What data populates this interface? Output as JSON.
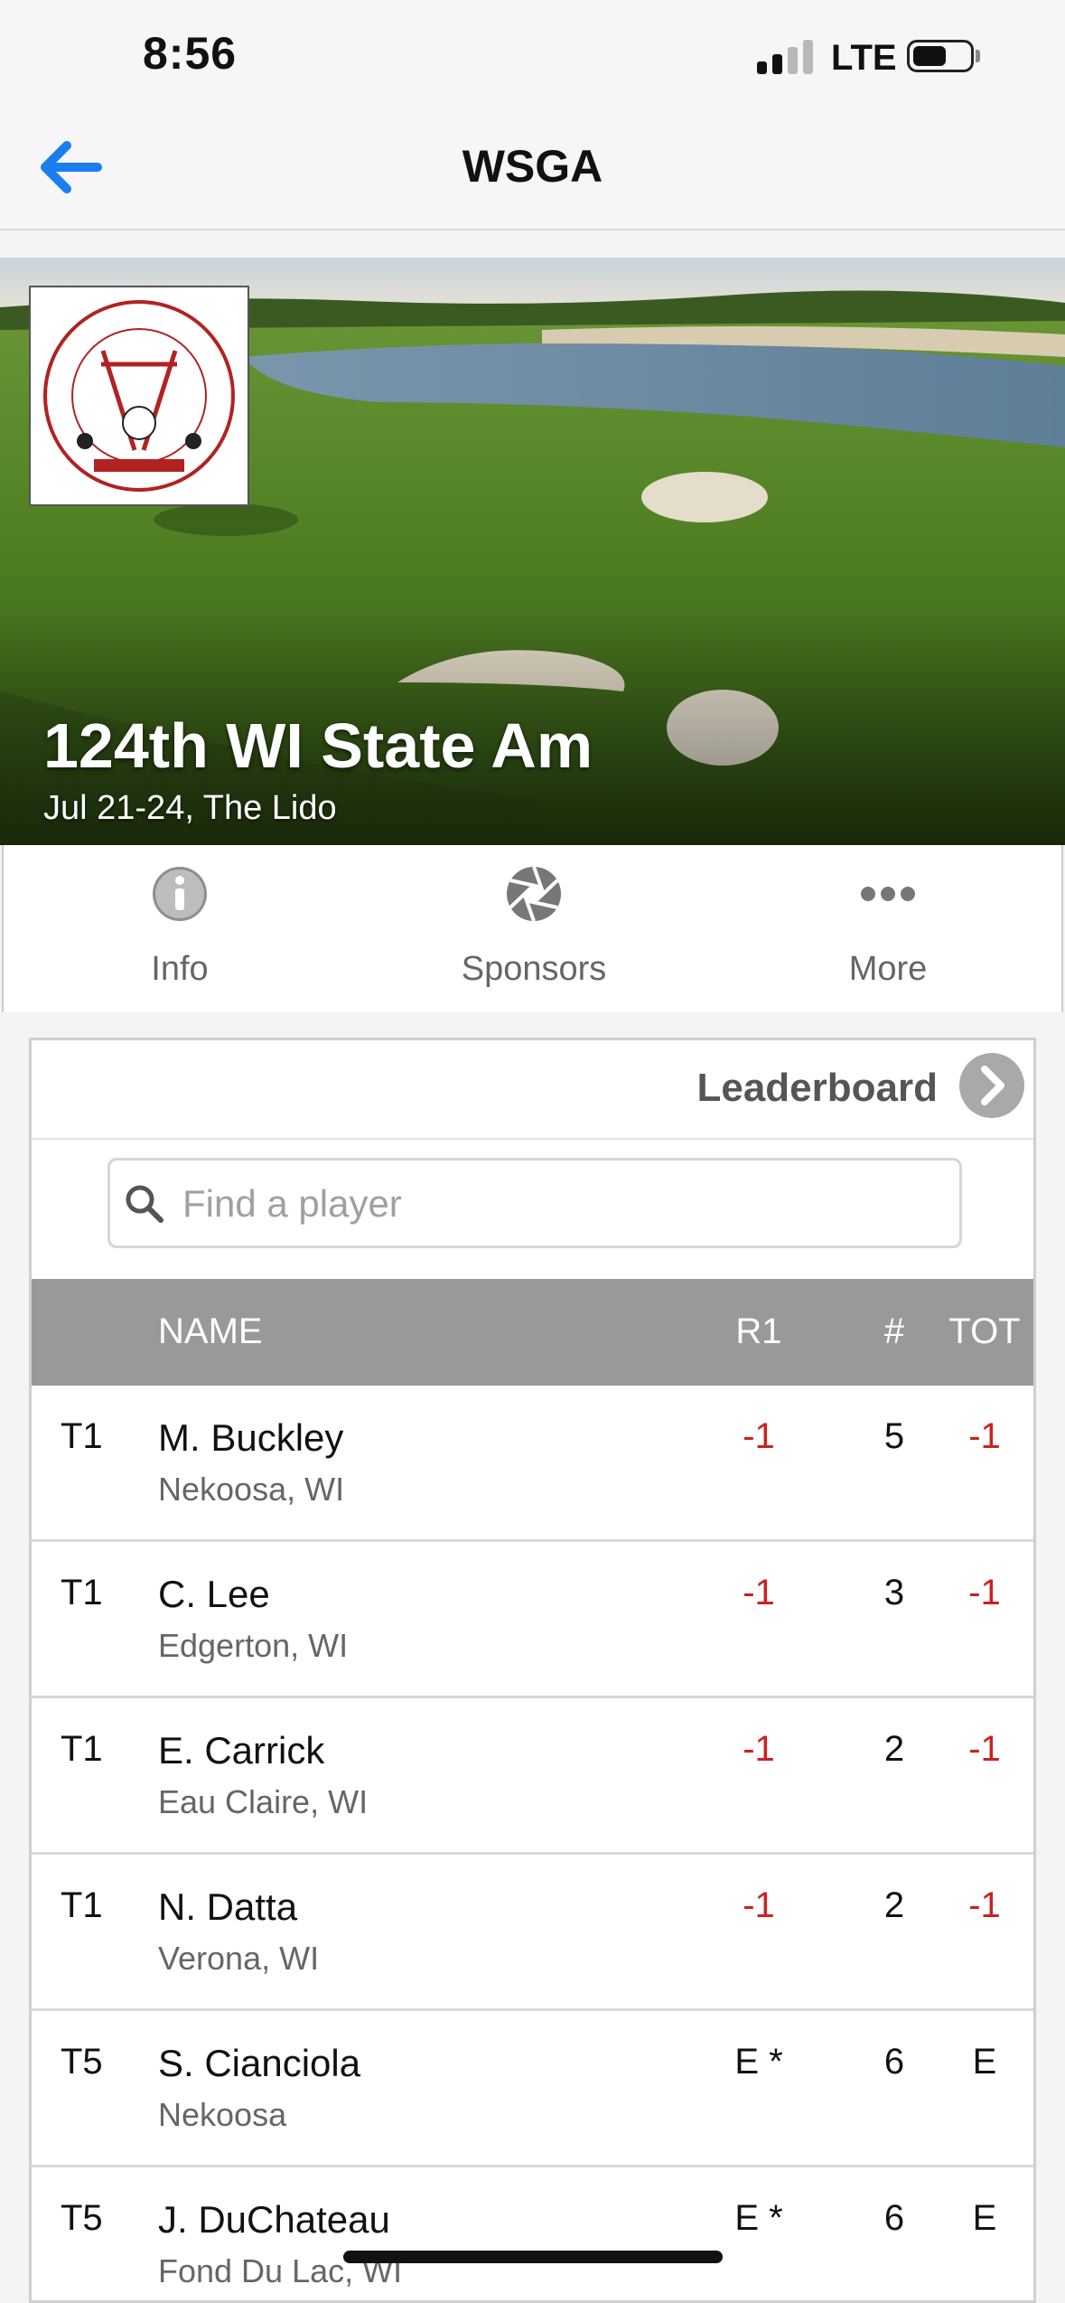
{
  "status_bar": {
    "time": "8:56",
    "network": "LTE"
  },
  "nav": {
    "title": "WSGA",
    "back_icon": "back-arrow-icon"
  },
  "hero": {
    "title": "124th WI State Am",
    "subtitle": "Jul 21-24, The Lido"
  },
  "tabs": [
    {
      "label": "Info",
      "icon": "info-icon"
    },
    {
      "label": "Sponsors",
      "icon": "aperture-icon"
    },
    {
      "label": "More",
      "icon": "more-dots-icon"
    }
  ],
  "leaderboard": {
    "title": "Leaderboard",
    "search_placeholder": "Find a player",
    "columns": {
      "name": "NAME",
      "r1": "R1",
      "num": "#",
      "tot": "TOT"
    },
    "rows": [
      {
        "pos": "T1",
        "name": "M. Buckley",
        "city": "Nekoosa, WI",
        "r1": "-1",
        "num": "5",
        "tot": "-1"
      },
      {
        "pos": "T1",
        "name": "C. Lee",
        "city": "Edgerton, WI",
        "r1": "-1",
        "num": "3",
        "tot": "-1"
      },
      {
        "pos": "T1",
        "name": "E. Carrick",
        "city": "Eau Claire, WI",
        "r1": "-1",
        "num": "2",
        "tot": "-1"
      },
      {
        "pos": "T1",
        "name": "N. Datta",
        "city": "Verona, WI",
        "r1": "-1",
        "num": "2",
        "tot": "-1"
      },
      {
        "pos": "T5",
        "name": "S. Cianciola",
        "city": "Nekoosa",
        "r1": "E *",
        "num": "6",
        "tot": "E"
      },
      {
        "pos": "T5",
        "name": "J. DuChateau",
        "city": "Fond Du Lac, WI",
        "r1": "E *",
        "num": "6",
        "tot": "E"
      }
    ]
  },
  "colors": {
    "accent": "#1a7ef0",
    "under_par": "#cc2020",
    "header_bg": "#999999"
  }
}
